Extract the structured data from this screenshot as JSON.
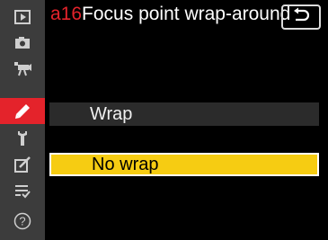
{
  "header": {
    "menu_code": "a16",
    "title": "Focus point wrap-around",
    "back_icon": "return-arrow-icon"
  },
  "sidebar": {
    "items": [
      {
        "icon": "playback-icon",
        "active": false
      },
      {
        "icon": "camera-icon",
        "active": false
      },
      {
        "icon": "movie-camera-icon",
        "active": false
      },
      {
        "icon": "pencil-icon",
        "active": true
      },
      {
        "icon": "wrench-icon",
        "active": false
      },
      {
        "icon": "retouch-icon",
        "active": false
      },
      {
        "icon": "my-menu-icon",
        "active": false
      },
      {
        "icon": "help-icon",
        "active": false
      }
    ]
  },
  "options": [
    {
      "label": "Wrap",
      "selected": false
    },
    {
      "label": "No wrap",
      "selected": true
    }
  ],
  "colors": {
    "active_tab": "#e4232b",
    "selection": "#f6cc12",
    "sidebar": "#3c3c3c"
  }
}
